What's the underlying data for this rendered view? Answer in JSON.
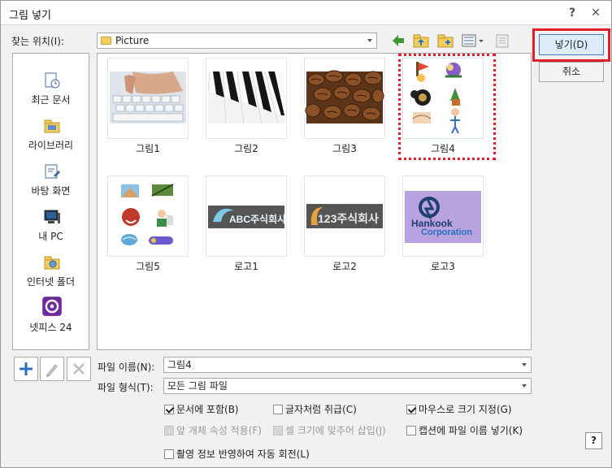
{
  "dialog": {
    "title": "그림 넣기",
    "help_glyph": "?",
    "close_glyph": "✕"
  },
  "location": {
    "label": "찾는 위치(I):",
    "value": "Picture"
  },
  "toolbar": {
    "icons": [
      "back-arrow-icon",
      "up-folder-icon",
      "new-folder-icon",
      "view-options-icon",
      "preview-icon"
    ]
  },
  "buttons": {
    "ok": "넣기(D)",
    "cancel": "취소"
  },
  "places": [
    {
      "label": "최근 문서",
      "icon": "recent-documents-icon"
    },
    {
      "label": "라이브러리",
      "icon": "library-icon"
    },
    {
      "label": "바탕 화면",
      "icon": "desktop-icon"
    },
    {
      "label": "내 PC",
      "icon": "my-pc-icon"
    },
    {
      "label": "인터넷 폴더",
      "icon": "internet-folder-icon"
    },
    {
      "label": "넷피스 24",
      "icon": "netffice-24-icon"
    }
  ],
  "files": [
    {
      "name": "그림1",
      "kind": "keyboard-photo"
    },
    {
      "name": "그림2",
      "kind": "piano-keys-photo"
    },
    {
      "name": "그림3",
      "kind": "coffee-beans-photo"
    },
    {
      "name": "그림4",
      "kind": "clipart-collage",
      "selected": true
    },
    {
      "name": "그림5",
      "kind": "clipart-collage-2"
    },
    {
      "name": "로고1",
      "kind": "logo-abc",
      "logo_text": "ABC주식회사"
    },
    {
      "name": "로고2",
      "kind": "logo-123",
      "logo_text": "123주식회사"
    },
    {
      "name": "로고3",
      "kind": "logo-hankook",
      "logo_text_1": "Hankook",
      "logo_text_2": "Corporation"
    }
  ],
  "file_name": {
    "label": "파일 이름(N):",
    "value": "그림4"
  },
  "file_type": {
    "label": "파일 형식(T):",
    "value": "모든 그림 파일"
  },
  "options": [
    {
      "label": "문서에 포함(B)",
      "checked": true,
      "disabled": false
    },
    {
      "label": "글자처럼 취급(C)",
      "checked": false,
      "disabled": false
    },
    {
      "label": "마우스로 크기 지정(G)",
      "checked": true,
      "disabled": false
    },
    {
      "label": "앞 개체 속성 적용(F)",
      "checked": false,
      "disabled": true
    },
    {
      "label": "셀 크기에 맞추어 삽입(J)",
      "checked": false,
      "disabled": true
    },
    {
      "label": "캡션에 파일 이름 넣기(K)",
      "checked": false,
      "disabled": false
    },
    {
      "label": "촬영 정보 반영하여 자동 회전(L)",
      "checked": false,
      "disabled": false
    }
  ],
  "colors": {
    "highlight": "#e01e2a",
    "ok_button": "#dcecfa",
    "nav_arrow": "#3c9a2e"
  }
}
